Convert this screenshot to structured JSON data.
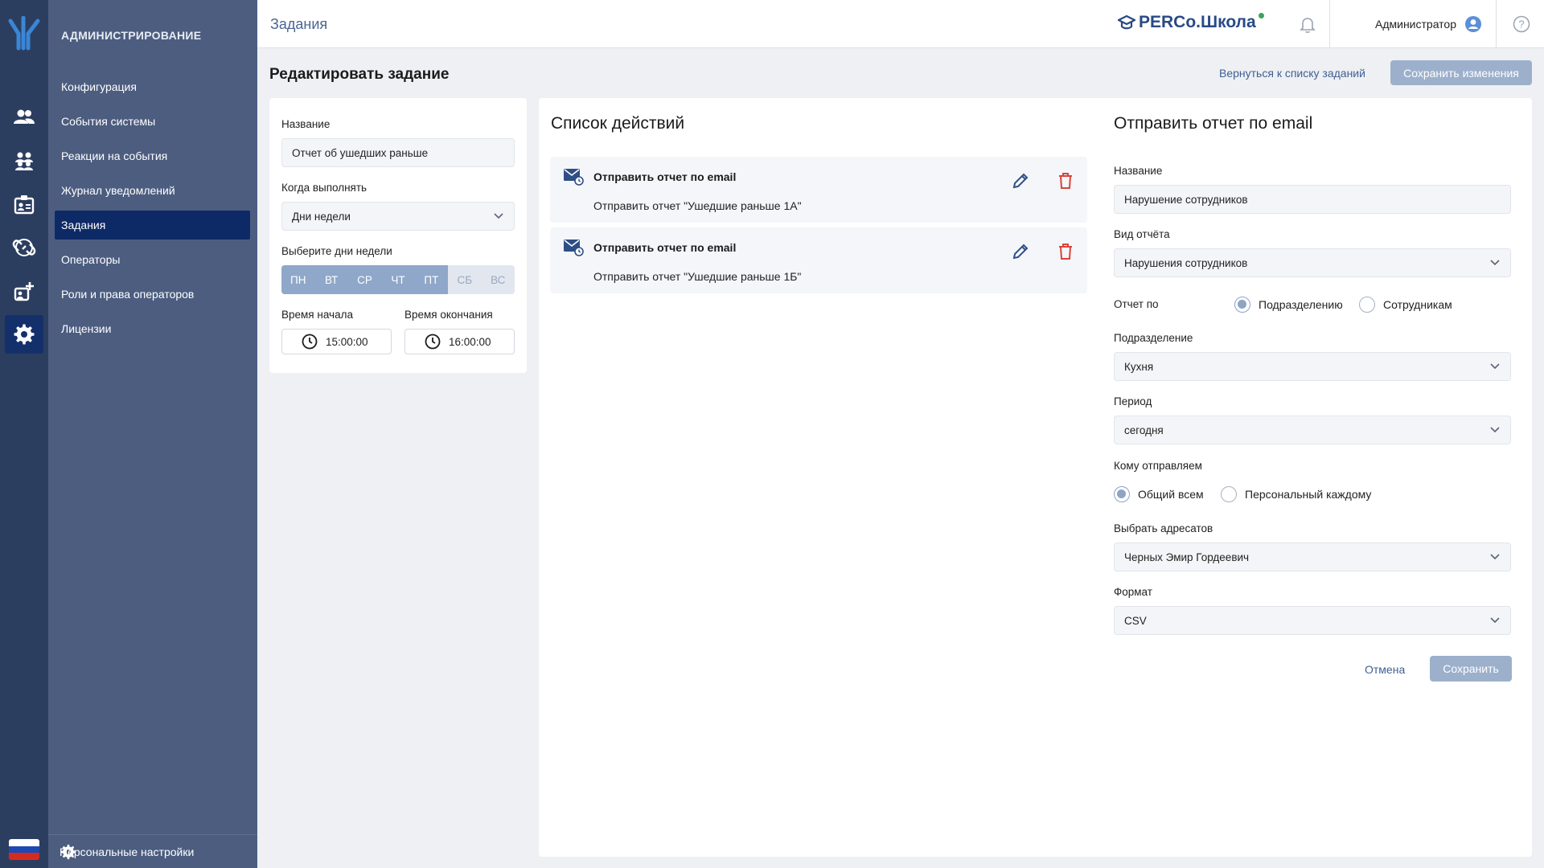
{
  "nav_rail": {
    "items": [
      {
        "icon": "users-icon"
      },
      {
        "icon": "group-icon"
      },
      {
        "icon": "id-badge-icon"
      },
      {
        "icon": "link-icon"
      },
      {
        "icon": "add-user-icon"
      },
      {
        "icon": "gear-icon",
        "active": true
      }
    ],
    "flag_colors": [
      "#ffffff",
      "#1c49b3",
      "#d52b1e"
    ]
  },
  "sidebar": {
    "section_title": "АДМИНИСТРИРОВАНИЕ",
    "items": [
      {
        "label": "Конфигурация"
      },
      {
        "label": "События системы"
      },
      {
        "label": "Реакции на события"
      },
      {
        "label": "Журнал уведомлений"
      },
      {
        "label": "Задания",
        "active": true
      },
      {
        "label": "Операторы"
      },
      {
        "label": "Роли и права операторов"
      },
      {
        "label": "Лицензии"
      }
    ],
    "personal_settings": "Персональные настройки"
  },
  "header": {
    "title": "Задания",
    "brand": "PERCo.Школа",
    "user_name": "Администратор"
  },
  "page": {
    "title": "Редактировать задание",
    "back_link": "Вернуться к списку заданий",
    "save_changes": "Сохранить изменения"
  },
  "task_form": {
    "name_label": "Название",
    "name_value": "Отчет об ушедших раньше",
    "when_label": "Когда выполнять",
    "when_value": "Дни недели",
    "days_label": "Выберите дни недели",
    "days": [
      {
        "label": "ПН",
        "selected": true
      },
      {
        "label": "ВТ",
        "selected": true
      },
      {
        "label": "СР",
        "selected": true
      },
      {
        "label": "ЧТ",
        "selected": true
      },
      {
        "label": "ПТ",
        "selected": true
      },
      {
        "label": "СБ",
        "selected": false
      },
      {
        "label": "ВС",
        "selected": false
      }
    ],
    "start_label": "Время начала",
    "start_value": "15:00:00",
    "end_label": "Время окончания",
    "end_value": "16:00:00"
  },
  "actions": {
    "title": "Список действий",
    "items": [
      {
        "title": "Отправить отчет по email",
        "description": "Отправить отчет \"Ушедшие раньше 1А\""
      },
      {
        "title": "Отправить отчет по email",
        "description": "Отправить отчет \"Ушедшие раньше 1Б\""
      }
    ]
  },
  "email_form": {
    "title": "Отправить отчет по email",
    "name_label": "Название",
    "name_value": "Нарушение сотрудников",
    "report_type_label": "Вид отчёта",
    "report_type_value": "Нарушения сотрудников",
    "report_by_label": "Отчет по",
    "report_by_options": [
      "Подразделению",
      "Сотрудникам"
    ],
    "report_by_selected": 0,
    "division_label": "Подразделение",
    "division_value": "Кухня",
    "period_label": "Период",
    "period_value": "сегодня",
    "send_to_label": "Кому отправляем",
    "send_to_options": [
      "Общий всем",
      "Персональный каждому"
    ],
    "send_to_selected": 0,
    "recipients_label": "Выбрать адресатов",
    "recipients_value": "Черных Эмир Гордеевич",
    "format_label": "Формат",
    "format_value": "CSV",
    "cancel": "Отмена",
    "save": "Сохранить"
  },
  "colors": {
    "rail_bg": "#2c3e5f",
    "sidebar_bg": "#4c5d80",
    "active_item": "#0e2a66",
    "primary_button": "#9cb0cc",
    "delete_icon": "#d9443b",
    "edit_icon": "#2e4e86"
  }
}
